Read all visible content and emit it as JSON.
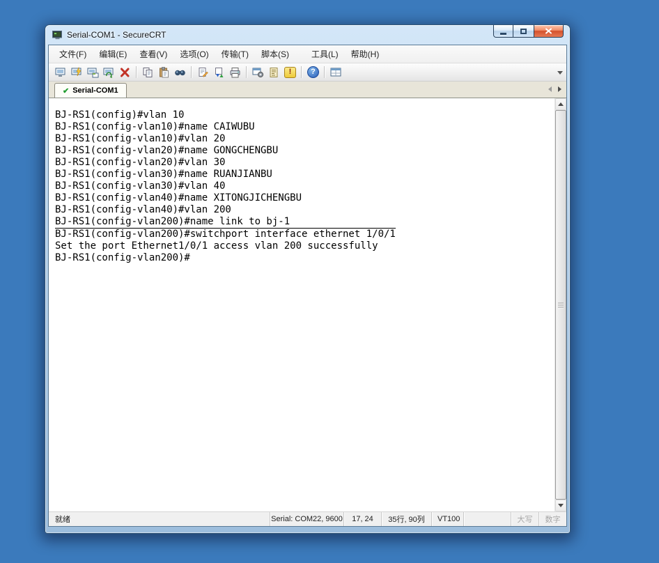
{
  "window": {
    "title": "Serial-COM1 - SecureCRT"
  },
  "menu": {
    "items": [
      {
        "label": "文件(F)"
      },
      {
        "label": "编辑(E)"
      },
      {
        "label": "查看(V)"
      },
      {
        "label": "选项(O)"
      },
      {
        "label": "传输(T)"
      },
      {
        "label": "脚本(S)"
      },
      {
        "label": "工具(L)"
      },
      {
        "label": "帮助(H)"
      }
    ]
  },
  "toolbar": {
    "icons": [
      "session-manager",
      "quick-connect",
      "connect-in-tab",
      "reconnect",
      "disconnect",
      "copy",
      "paste",
      "find",
      "log-session",
      "file-transfer",
      "print",
      "session-options",
      "run-script",
      "break-key",
      "help",
      "session-tabs"
    ],
    "break_glyph": "!",
    "help_glyph": "?"
  },
  "tabbar": {
    "tabs": [
      {
        "label": "Serial-COM1",
        "check_glyph": "✔"
      }
    ]
  },
  "terminal": {
    "lines": [
      "BJ-RS1(config)#vlan 10",
      "BJ-RS1(config-vlan10)#name CAIWUBU",
      "BJ-RS1(config-vlan10)#vlan 20",
      "BJ-RS1(config-vlan20)#name GONGCHENGBU",
      "BJ-RS1(config-vlan20)#vlan 30",
      "BJ-RS1(config-vlan30)#name RUANJIANBU",
      "BJ-RS1(config-vlan30)#vlan 40",
      "BJ-RS1(config-vlan40)#name XITONGJICHENGBU",
      "BJ-RS1(config-vlan40)#vlan 200",
      "BJ-RS1(config-vlan200)#name link to bj-1",
      "BJ-RS1(config-vlan200)#switchport interface ethernet 1/0/1",
      "Set the port Ethernet1/0/1 access vlan 200 successfully",
      "BJ-RS1(config-vlan200)#"
    ],
    "overline_line_index": 10
  },
  "statusbar": {
    "ready": "就绪",
    "serial": "Serial: COM22, 9600",
    "cursor_pos": "17, 24",
    "screen_size": "35行, 90列",
    "emulation": "VT100",
    "caps_label": "大写",
    "num_label": "数字"
  }
}
